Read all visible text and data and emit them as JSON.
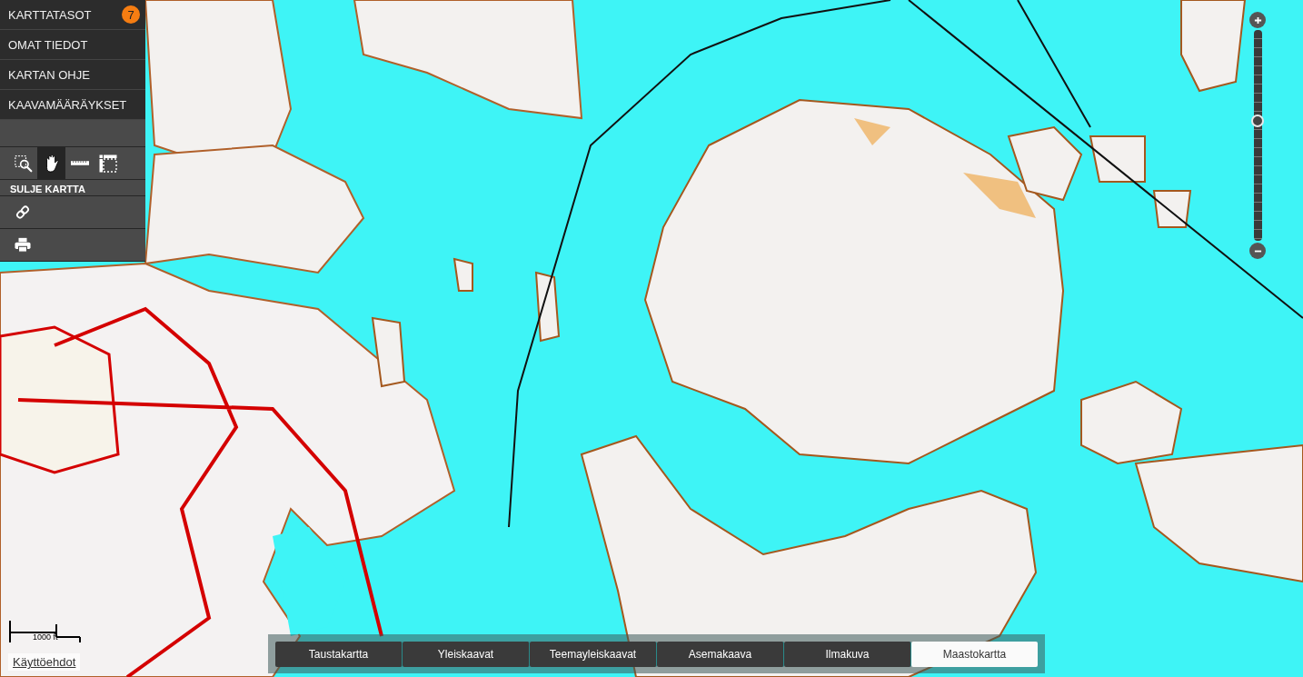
{
  "menu": [
    {
      "label": "KARTTATASOT",
      "badge": "7"
    },
    {
      "label": "OMAT TIEDOT"
    },
    {
      "label": "KARTAN OHJE"
    },
    {
      "label": "KAAVAMÄÄRÄYKSET"
    }
  ],
  "tools": [
    {
      "kind": "zoom-box",
      "selected": false
    },
    {
      "kind": "pan",
      "selected": true
    },
    {
      "kind": "measure-line",
      "selected": false
    },
    {
      "kind": "measure-area",
      "selected": false
    }
  ],
  "close_map": {
    "label": "SULJE KARTTA"
  },
  "actions": [
    {
      "kind": "link"
    },
    {
      "kind": "print"
    }
  ],
  "zoom_slider": {
    "level": 0.57
  },
  "scale_bar": {
    "label": "1000 ft"
  },
  "terms_link": {
    "label": "Käyttöehdot"
  },
  "base_map_tabs": [
    {
      "label": "Taustakartta",
      "selected": false
    },
    {
      "label": "Yleiskaavat",
      "selected": false
    },
    {
      "label": "Teemayleiskaavat",
      "selected": false
    },
    {
      "label": "Asemakaava",
      "selected": false
    },
    {
      "label": "Ilmakuva",
      "selected": false
    },
    {
      "label": "Maastokartta",
      "selected": true
    }
  ]
}
